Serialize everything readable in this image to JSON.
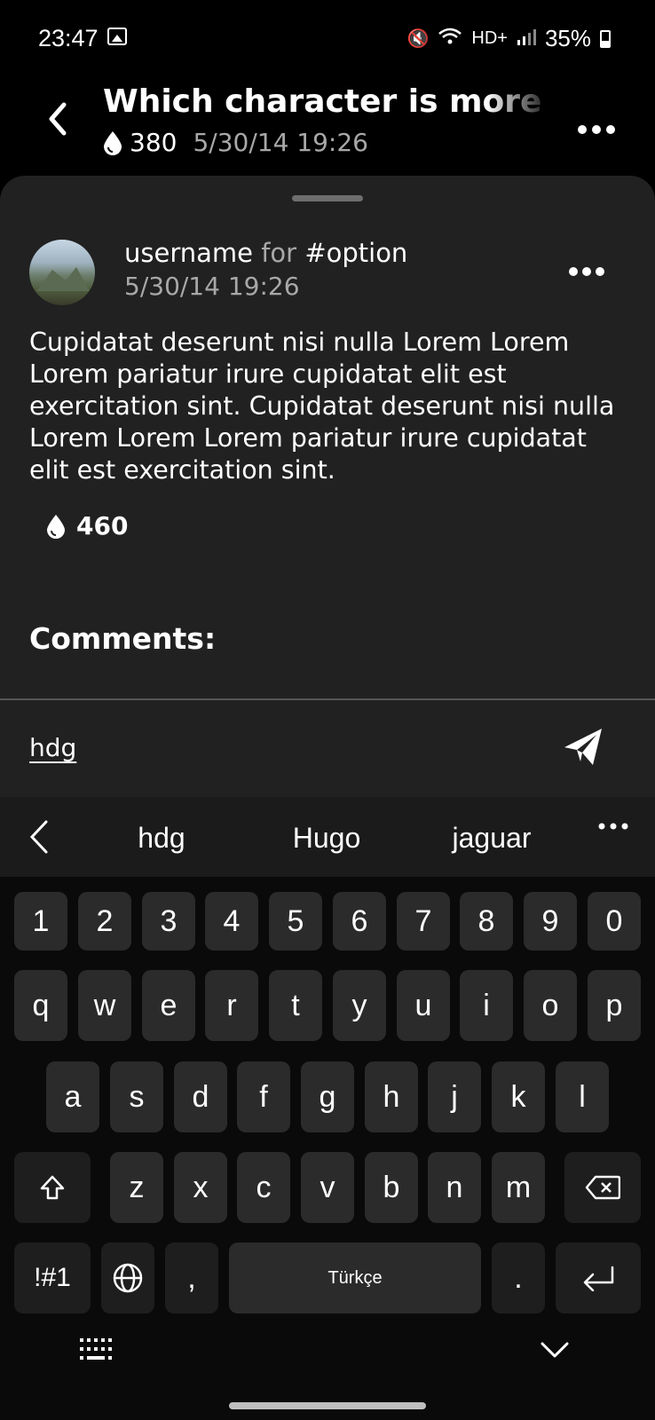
{
  "status_bar": {
    "time": "23:47",
    "battery": "35%",
    "network": "HD+"
  },
  "header": {
    "title": "Which character is more like",
    "likes": "380",
    "date": "5/30/14 19:26"
  },
  "post": {
    "username": "username",
    "for_word": "for",
    "option": "#option",
    "date": "5/30/14 19:26",
    "body": "Cupidatat deserunt nisi nulla Lorem Lorem Lorem pariatur irure cupidatat elit est exercitation sint. Cupidatat deserunt nisi nulla Lorem Lorem Lorem pariatur irure cupidatat elit est exercitation sint.",
    "likes": "460"
  },
  "comments": {
    "label": "Comments:",
    "input_value": "hdg"
  },
  "keyboard": {
    "suggestions": [
      "hdg",
      "Hugo",
      "jaguar"
    ],
    "numbers": [
      "1",
      "2",
      "3",
      "4",
      "5",
      "6",
      "7",
      "8",
      "9",
      "0"
    ],
    "row1": [
      "q",
      "w",
      "e",
      "r",
      "t",
      "y",
      "u",
      "i",
      "o",
      "p"
    ],
    "row2": [
      "a",
      "s",
      "d",
      "f",
      "g",
      "h",
      "j",
      "k",
      "l"
    ],
    "row3": [
      "z",
      "x",
      "c",
      "v",
      "b",
      "n",
      "m"
    ],
    "symbols": "!#1",
    "comma": ",",
    "space": "Türkçe",
    "period": "."
  },
  "icons": {
    "back": "chevron-left-icon",
    "drop": "drop-icon",
    "more": "more-horizontal-icon",
    "send": "send-icon"
  }
}
